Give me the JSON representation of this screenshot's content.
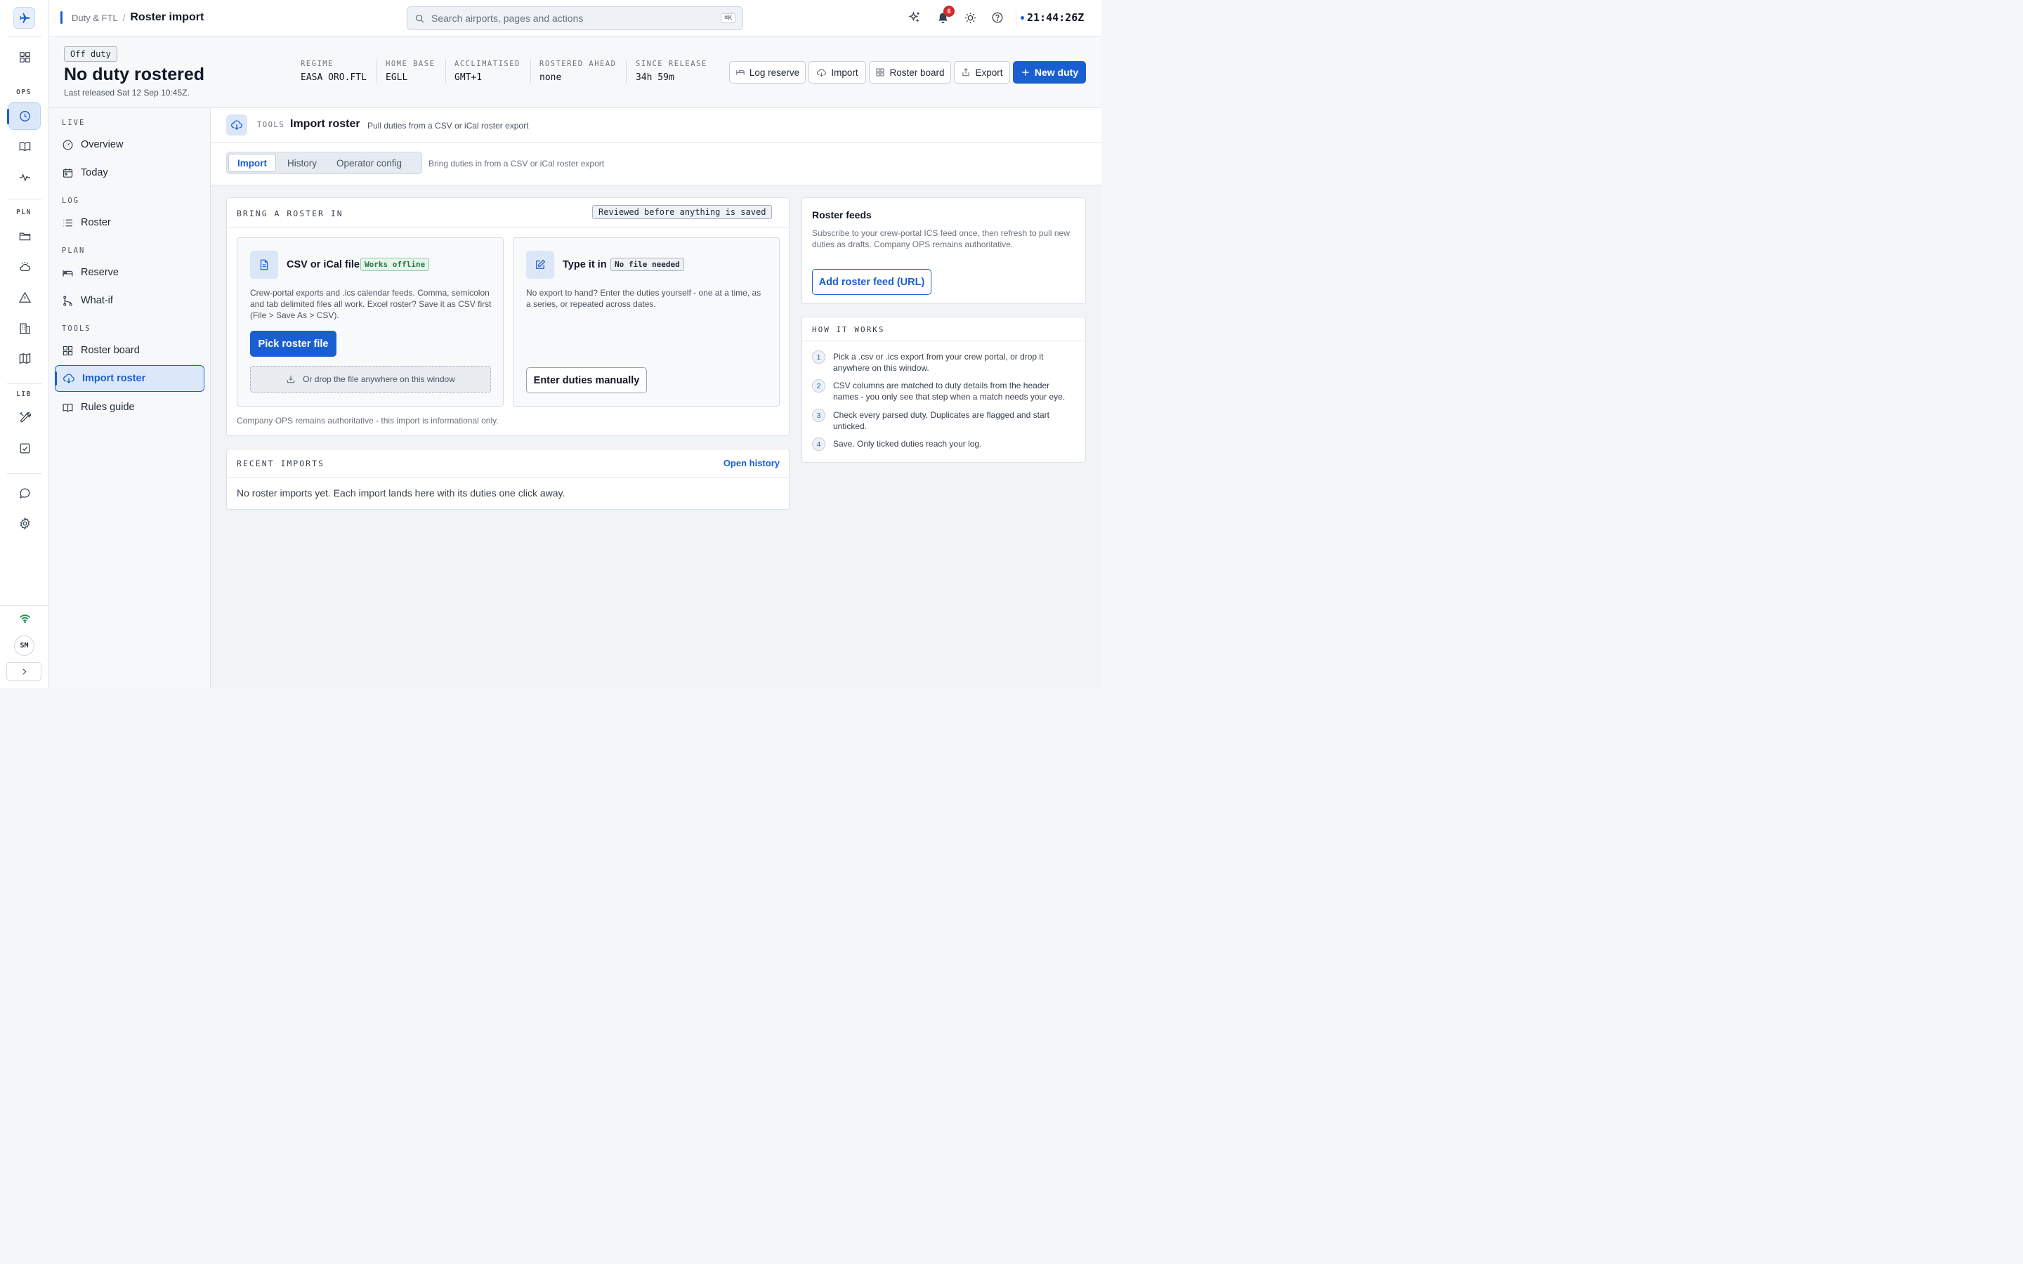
{
  "topbar": {
    "breadcrumb_parent": "Duty & FTL",
    "breadcrumb_separator": "/",
    "breadcrumb_current": "Roster import",
    "search_placeholder": "Search airports, pages and actions",
    "search_shortcut": "⌘K",
    "notifications_count": "6",
    "clock": "21:44:26Z"
  },
  "rail": {
    "sections": [
      "OPS",
      "PLN",
      "LIB"
    ],
    "user_initials": "SM",
    "icons": [
      "plane-icon",
      "grid-icon",
      "clock-icon",
      "book-icon",
      "activity-icon",
      "folder-icon",
      "weather-icon",
      "warning-icon",
      "building-icon",
      "map-icon",
      "tools-icon",
      "checkbox-icon",
      "chat-icon",
      "gear-icon",
      "wifi-icon",
      "chevron-right-icon"
    ]
  },
  "status": {
    "pill": "Off duty",
    "title": "No duty rostered",
    "released": "Last released Sat 12 Sep 10:45Z.",
    "metrics": [
      {
        "key": "REGIME",
        "value": "EASA ORO.FTL"
      },
      {
        "key": "HOME BASE",
        "value": "EGLL"
      },
      {
        "key": "ACCLIMATISED",
        "value": "GMT+1"
      },
      {
        "key": "ROSTERED AHEAD",
        "value": "none"
      },
      {
        "key": "SINCE RELEASE",
        "value": "34h 59m"
      }
    ],
    "buttons": {
      "log_reserve": "Log reserve",
      "import": "Import",
      "roster_board": "Roster board",
      "export": "Export",
      "new_duty": "New duty"
    }
  },
  "nav": {
    "sections": {
      "live": "LIVE",
      "log": "LOG",
      "plan": "PLAN",
      "tools": "TOOLS"
    },
    "items": {
      "overview": "Overview",
      "today": "Today",
      "roster": "Roster",
      "reserve": "Reserve",
      "whatif": "What-if",
      "roster_board": "Roster board",
      "import_roster": "Import roster",
      "rules_guide": "Rules guide"
    },
    "active": "Import roster"
  },
  "page": {
    "section_label": "TOOLS",
    "title": "Import roster",
    "description": "Pull duties from a CSV or iCal roster export",
    "tabs": [
      "Import",
      "History",
      "Operator config"
    ],
    "active_tab": "Import",
    "tabs_note": "Bring duties in from a CSV or iCal roster export"
  },
  "bring": {
    "heading": "BRING A ROSTER IN",
    "tag": "Reviewed before anything is saved",
    "csv": {
      "title": "CSV or iCal file",
      "tag": "Works offline",
      "desc": "Crew-portal exports and .ics calendar feeds. Comma, semicolon and tab delimited files all work. Excel roster? Save it as CSV first (File > Save As > CSV).",
      "button": "Pick roster file",
      "drop": "Or drop the file anywhere on this window"
    },
    "manual": {
      "title": "Type it in",
      "tag": "No file needed",
      "desc": "No export to hand? Enter the duties yourself - one at a time, as a series, or repeated across dates.",
      "button": "Enter duties manually"
    },
    "footnote": "Company OPS remains authoritative - this import is informational only."
  },
  "recent": {
    "heading": "RECENT IMPORTS",
    "link": "Open history",
    "empty": "No roster imports yet. Each import lands here with its duties one click away."
  },
  "feeds": {
    "title": "Roster feeds",
    "desc": "Subscribe to your crew-portal ICS feed once, then refresh to pull new duties as drafts. Company OPS remains authoritative.",
    "button": "Add roster feed (URL)"
  },
  "how": {
    "heading": "HOW IT WORKS",
    "steps": [
      {
        "n": "1",
        "text": "Pick a .csv or .ics export from your crew portal, or drop it anywhere on this window."
      },
      {
        "n": "2",
        "text": "CSV columns are matched to duty details from the header names - you only see that step when a match needs your eye."
      },
      {
        "n": "3",
        "text": "Check every parsed duty. Duplicates are flagged and start unticked."
      },
      {
        "n": "4",
        "text": "Save. Only ticked duties reach your log."
      }
    ]
  },
  "colors": {
    "accent": "#1a5fd1",
    "success": "#1b7a43",
    "danger": "#d02b2b"
  }
}
